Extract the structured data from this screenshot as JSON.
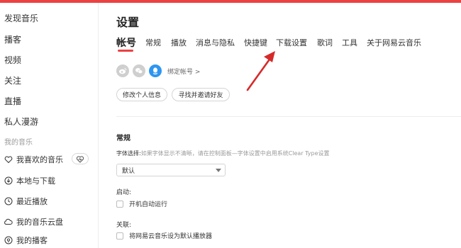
{
  "colors": {
    "accent": "#ec4141",
    "weibo": "#cfcfcf",
    "wechat": "#cfcfcf",
    "qq": "#2e96f0",
    "annotation_arrow": "#d62a2a"
  },
  "sidebar": {
    "nav_items": [
      "发现音乐",
      "播客",
      "视频",
      "关注",
      "直播",
      "私人漫游"
    ],
    "section_label": "我的音乐",
    "music_items": [
      {
        "label": "我喜欢的音乐",
        "icon": "heart-icon"
      },
      {
        "label": "本地与下载",
        "icon": "download-icon"
      },
      {
        "label": "最近播放",
        "icon": "clock-icon"
      },
      {
        "label": "我的音乐云盘",
        "icon": "cloud-icon"
      },
      {
        "label": "我的播客",
        "icon": "podcast-icon"
      }
    ],
    "heartbeat_mode_icon": "heartbeat-mode-icon"
  },
  "main": {
    "title": "设置",
    "tabs": [
      "帐号",
      "常规",
      "播放",
      "消息与隐私",
      "快捷键",
      "下载设置",
      "歌词",
      "工具",
      "关于网易云音乐"
    ],
    "active_tab_index": 0,
    "account": {
      "social_icons": [
        "weibo-icon",
        "wechat-icon",
        "qq-icon"
      ],
      "bind_label": "绑定帐号 >",
      "edit_profile_button": "修改个人信息",
      "invite_friends_button": "寻找并邀请好友"
    },
    "general": {
      "title": "常规",
      "font_label": "字体选择:",
      "font_hint": "如果字体显示不清晰，请在控制面板—字体设置中启用系统Clear Type设置",
      "font_value": "默认",
      "startup_label": "启动:",
      "startup_checkbox": "开机自动运行",
      "startup_checked": false,
      "association_label": "关联:",
      "association_checkbox": "将网易云音乐设为默认播放器",
      "association_checked": false
    }
  }
}
